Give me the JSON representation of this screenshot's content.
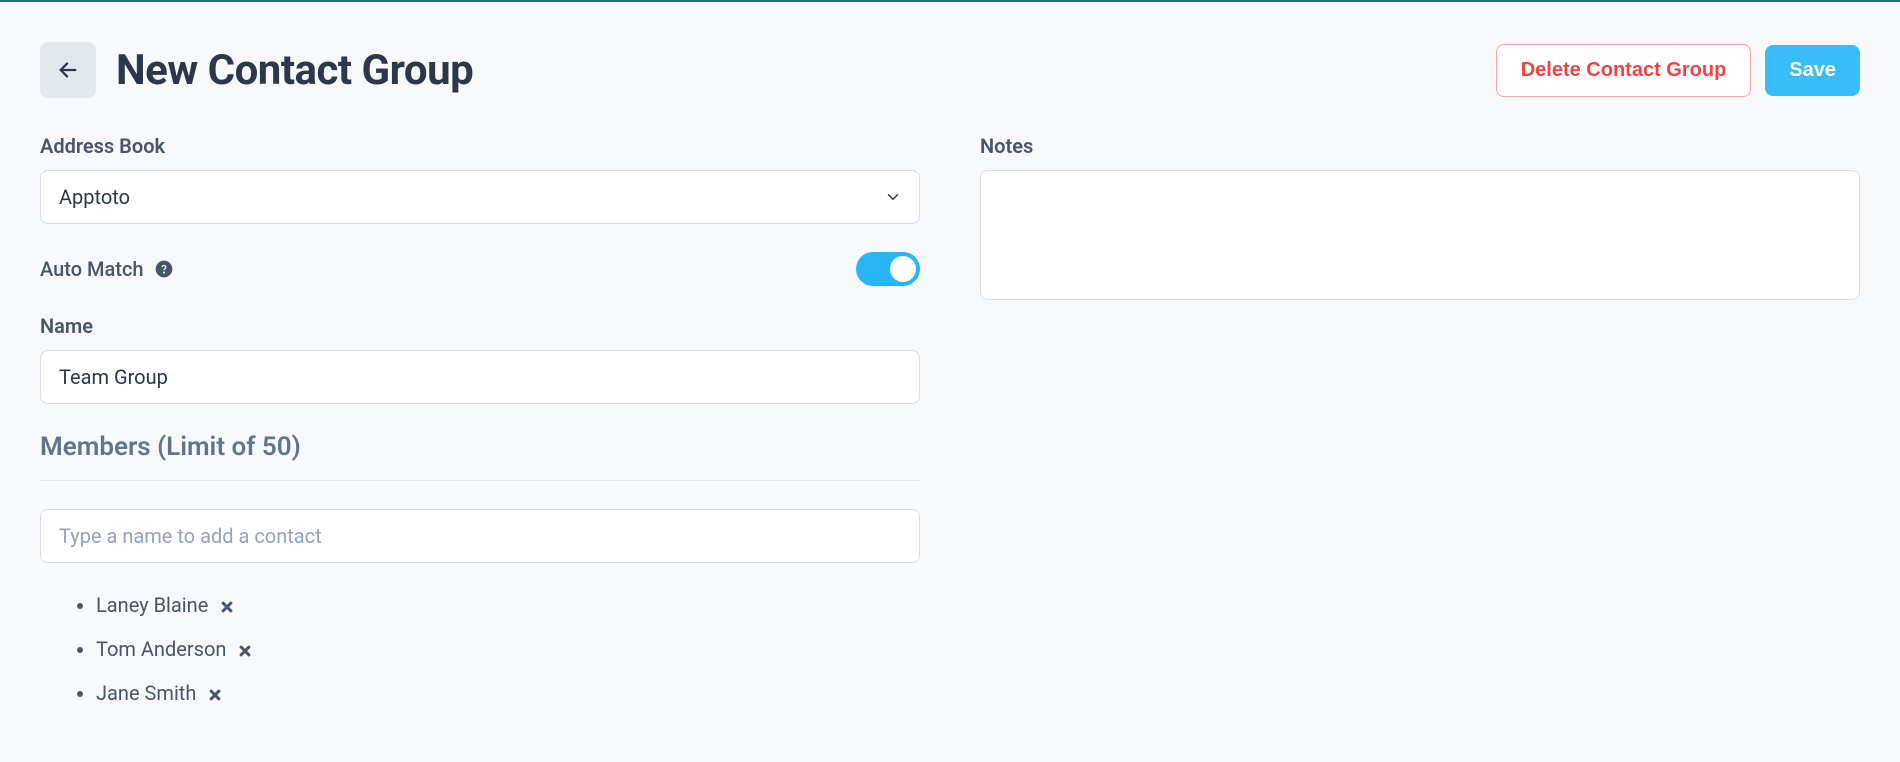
{
  "header": {
    "title": "New Contact Group",
    "delete_label": "Delete Contact Group",
    "save_label": "Save"
  },
  "left": {
    "address_book_label": "Address Book",
    "address_book_value": "Apptoto",
    "auto_match_label": "Auto Match",
    "auto_match_on": true,
    "name_label": "Name",
    "name_value": "Team Group",
    "members_heading": "Members (Limit of 50)",
    "add_contact_placeholder": "Type a name to add a contact",
    "members": [
      {
        "name": "Laney Blaine"
      },
      {
        "name": "Tom Anderson"
      },
      {
        "name": "Jane Smith"
      }
    ]
  },
  "right": {
    "notes_label": "Notes",
    "notes_value": ""
  }
}
